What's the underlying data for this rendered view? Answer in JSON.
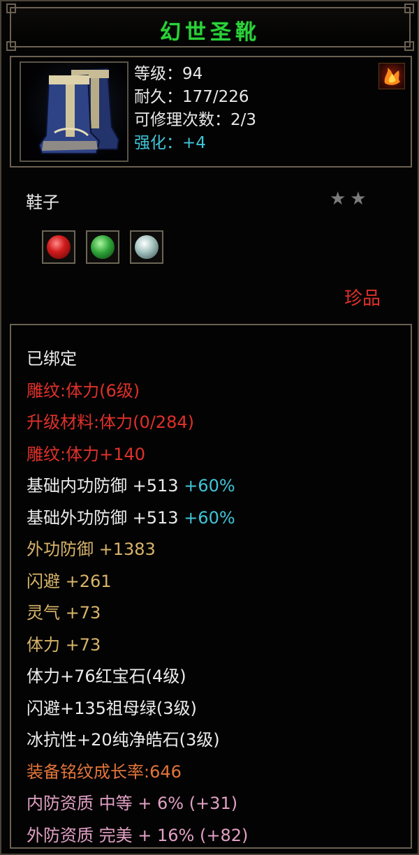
{
  "item": {
    "title": "幻世圣靴",
    "level": "等级：94",
    "durability": "耐久：177/226",
    "repair": "可修理次数：2/3",
    "enhance": "强化：+4",
    "type": "鞋子",
    "stars": "★★",
    "rarity": "珍品"
  },
  "attributes": {
    "bound": "已绑定",
    "engrave1": "雕纹:体力(6级)",
    "upgrade_material": "升级材料:体力(0/284)",
    "engrave2": "雕纹:体力+140",
    "base_inner_def": "基础内功防御  +513",
    "base_inner_def_pct": "+60%",
    "base_outer_def": "基础外功防御  +513",
    "base_outer_def_pct": "+60%",
    "outer_def": "外功防御  +1383",
    "dodge": "闪避  +261",
    "spirit": "灵气  +73",
    "stamina": "体力  +73",
    "gem1": "体力+76红宝石(4级)",
    "gem2": "闪避+135祖母绿(3级)",
    "gem3": "冰抗性+20纯净皓石(3级)",
    "growth": "装备铭纹成长率:646",
    "inner_quality": "内防资质  中等  +  6% (+31)",
    "outer_quality": "外防资质  完美  +  16% (+82)"
  },
  "colors": {
    "title_green": "#2bd23a",
    "red": "#e0302a",
    "gold": "#d8b46a",
    "cyan": "#3fc5d8",
    "orange": "#e2743a",
    "pink": "#e1a0c4"
  },
  "icons": [
    "boots-icon",
    "fire-icon",
    "ruby-gem-icon",
    "emerald-gem-icon",
    "diamond-gem-icon"
  ]
}
